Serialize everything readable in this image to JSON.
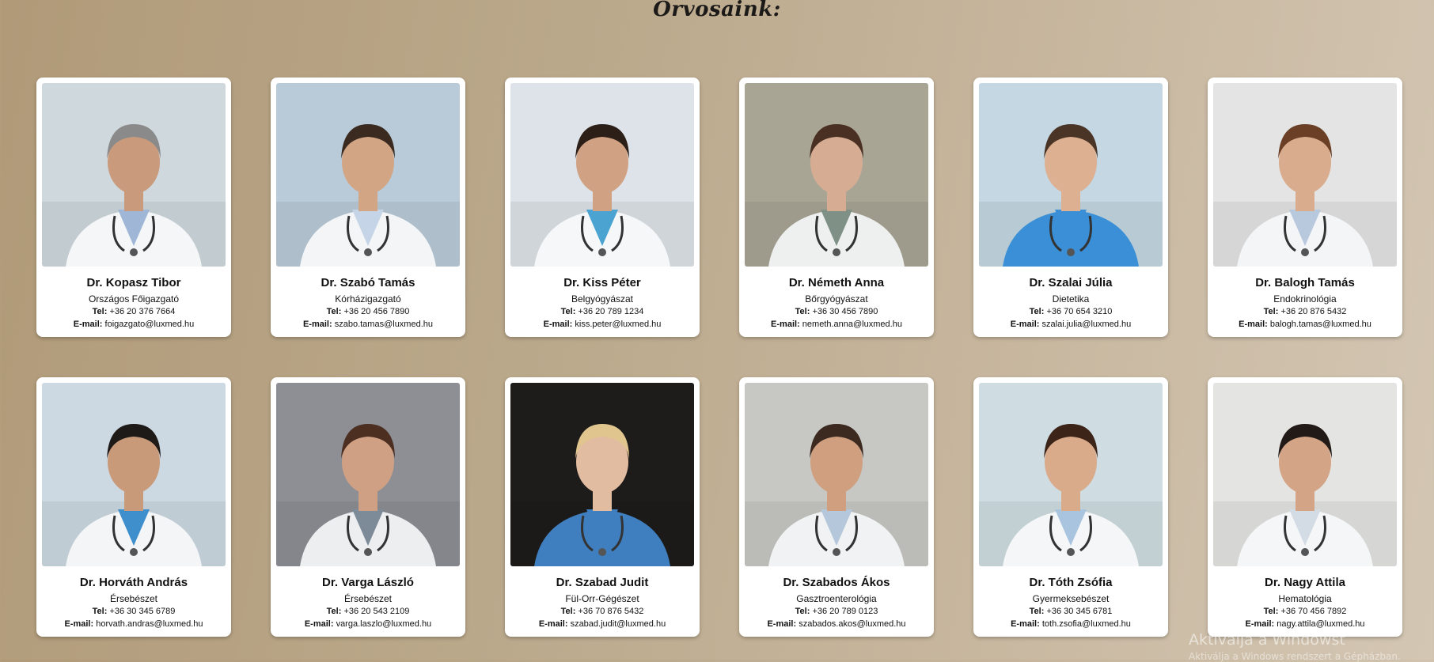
{
  "page": {
    "title": "Orvosaink:"
  },
  "labels": {
    "tel": "Tel:",
    "email": "E-mail:"
  },
  "doctors": [
    {
      "name": "Dr. Kopasz Tibor",
      "role": "Országos Főigazgató",
      "tel": "+36 20 376 7664",
      "email": "foigazgato@luxmed.hu",
      "bg": "#cfd8dc",
      "coat": "#f4f6f8",
      "shirt": "#9fb6d6",
      "skin": "#c99a7c",
      "hair": "#8a8a8a"
    },
    {
      "name": "Dr. Szabó Tamás",
      "role": "Kórházigazgató",
      "tel": "+36 20 456 7890",
      "email": "szabo.tamas@luxmed.hu",
      "bg": "#b9cbd8",
      "coat": "#f3f5f7",
      "shirt": "#c5d4e6",
      "skin": "#d2a585",
      "hair": "#3a2a20"
    },
    {
      "name": "Dr. Kiss Péter",
      "role": "Belgyógyászat",
      "tel": "+36 20 789 1234",
      "email": "kiss.peter@luxmed.hu",
      "bg": "#dde3e8",
      "coat": "#f5f7f9",
      "shirt": "#4aa3d0",
      "skin": "#d0a283",
      "hair": "#2b1f18"
    },
    {
      "name": "Dr. Németh Anna",
      "role": "Bőrgyógyászat",
      "tel": "+36 30 456 7890",
      "email": "nemeth.anna@luxmed.hu",
      "bg": "#a9a595",
      "coat": "#eef0ef",
      "shirt": "#7f9186",
      "skin": "#d6ad93",
      "hair": "#4a3022"
    },
    {
      "name": "Dr. Szalai Júlia",
      "role": "Dietetika",
      "tel": "+36 70 654 3210",
      "email": "szalai.julia@luxmed.hu",
      "bg": "#c4d7e2",
      "coat": "#3a8fd6",
      "shirt": "#3a8fd6",
      "skin": "#dcb091",
      "hair": "#4a3426"
    },
    {
      "name": "Dr. Balogh Tamás",
      "role": "Endokrinológia",
      "tel": "+36 20 876 5432",
      "email": "balogh.tamas@luxmed.hu",
      "bg": "#e3e4e3",
      "coat": "#f4f5f6",
      "shirt": "#b8c9de",
      "skin": "#d8ac8c",
      "hair": "#6a3f26"
    },
    {
      "name": "Dr. Horváth András",
      "role": "Érsebészet",
      "tel": "+36 30 345 6789",
      "email": "horvath.andras@luxmed.hu",
      "bg": "#cdd9e2",
      "coat": "#f3f5f7",
      "shirt": "#3f8fcc",
      "skin": "#c99a7a",
      "hair": "#1e1a18"
    },
    {
      "name": "Dr. Varga László",
      "role": "Érsebészet",
      "tel": "+36 20 543 2109",
      "email": "varga.laszlo@luxmed.hu",
      "bg": "#8d8f95",
      "coat": "#eceef0",
      "shirt": "#7d8a98",
      "skin": "#cfa084",
      "hair": "#4d2f22"
    },
    {
      "name": "Dr. Szabad Judit",
      "role": "Fül-Orr-Gégészet",
      "tel": "+36 70 876 5432",
      "email": "szabad.judit@luxmed.hu",
      "bg": "#1e1c1b",
      "coat": "#3f7fbf",
      "shirt": "#3f7fbf",
      "skin": "#e2bca1",
      "hair": "#e0c68e"
    },
    {
      "name": "Dr. Szabados Ákos",
      "role": "Gasztroenterológia",
      "tel": "+36 20 789 0123",
      "email": "szabados.akos@luxmed.hu",
      "bg": "#c7c8c4",
      "coat": "#f1f2f3",
      "shirt": "#b5c7db",
      "skin": "#cf9f80",
      "hair": "#3c2a20"
    },
    {
      "name": "Dr. Tóth Zsófia",
      "role": "Gyermeksebészet",
      "tel": "+36 30 345 6781",
      "email": "toth.zsofia@luxmed.hu",
      "bg": "#cfdde2",
      "coat": "#f4f6f7",
      "shirt": "#a8c4de",
      "skin": "#d9ab8b",
      "hair": "#3c2418"
    },
    {
      "name": "Dr. Nagy Attila",
      "role": "Hematológia",
      "tel": "+36 70 456 7892",
      "email": "nagy.attila@luxmed.hu",
      "bg": "#e4e4e2",
      "coat": "#f5f6f7",
      "shirt": "#d3dbe4",
      "skin": "#d3a485",
      "hair": "#221a16"
    }
  ],
  "watermark": {
    "title": "Aktiválja a Windowst",
    "subtitle": "Aktiválja a Windows rendszert a Gépházban."
  }
}
